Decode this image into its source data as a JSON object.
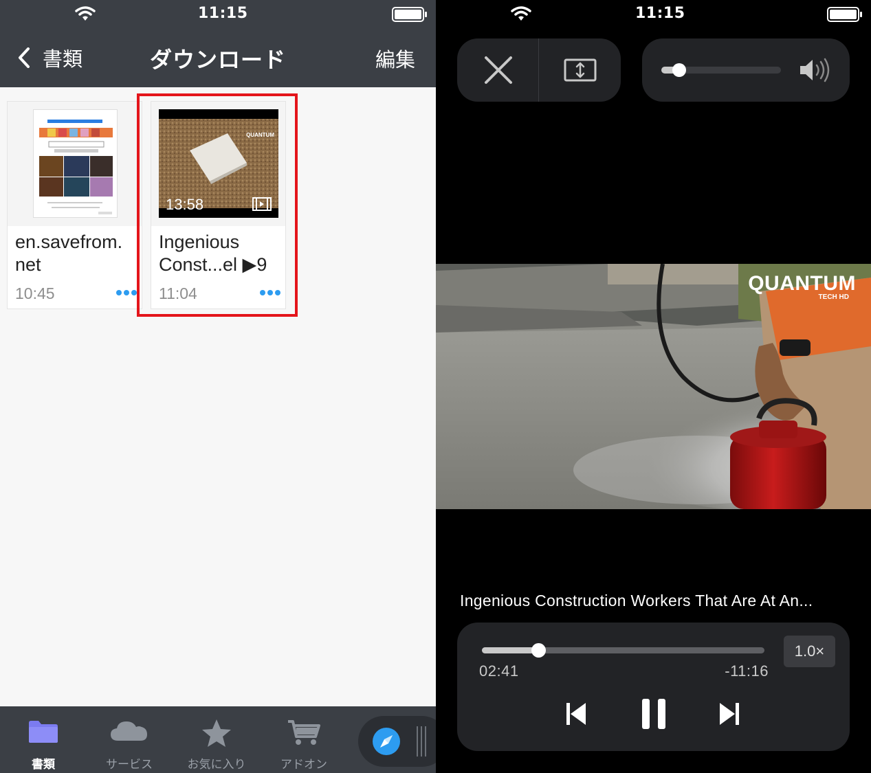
{
  "left": {
    "status": {
      "time": "11:15"
    },
    "nav": {
      "back_label": "書類",
      "title": "ダウンロード",
      "edit_label": "編集"
    },
    "files": [
      {
        "name": "en.savefrom.\nnet",
        "time": "10:45",
        "type": "document"
      },
      {
        "name": "Ingenious\nConst...el ▶9",
        "time": "11:04",
        "type": "video",
        "duration": "13:58",
        "watermark": "QUANTUM"
      }
    ],
    "tabs": [
      {
        "label": "書類",
        "icon": "folder-icon",
        "active": true
      },
      {
        "label": "サービス",
        "icon": "cloud-icon",
        "active": false
      },
      {
        "label": "お気に入り",
        "icon": "star-icon",
        "active": false
      },
      {
        "label": "アドオン",
        "icon": "cart-icon",
        "active": false
      }
    ],
    "browser_icon": "compass-icon",
    "colors": {
      "bar": "#3b3f45",
      "highlight": "#e4151b",
      "accent": "#2d9cf0"
    }
  },
  "right": {
    "status": {
      "time": "11:15"
    },
    "volume_level": 0.15,
    "video": {
      "watermark": "QUANTUM",
      "watermark_sub": "TECH HD",
      "title": "Ingenious Construction Workers That Are At An...",
      "current_time": "02:41",
      "remaining_time": "-11:16",
      "progress": 0.2,
      "speed": "1.0×"
    }
  }
}
